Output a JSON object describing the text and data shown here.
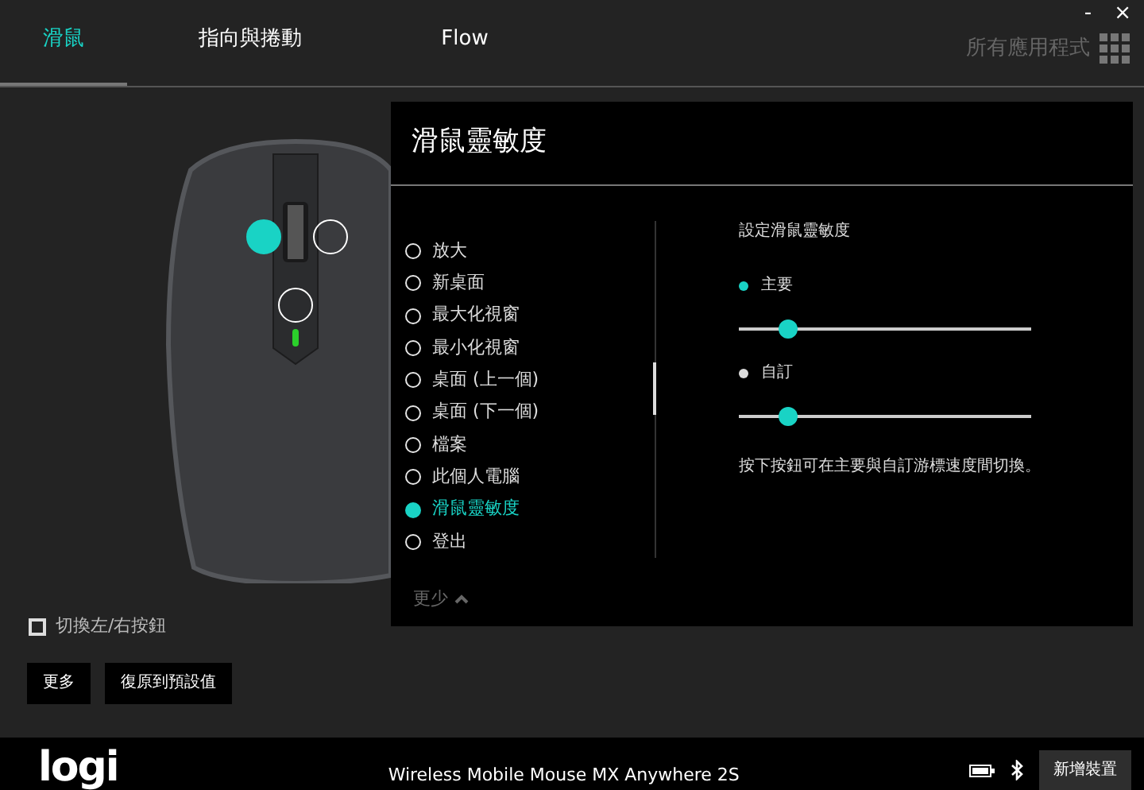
{
  "window": {
    "controls": [
      "-",
      "×"
    ]
  },
  "tabs": [
    {
      "label": "滑鼠",
      "selected": true
    },
    {
      "label": "指向與捲動",
      "selected": false
    },
    {
      "label": "Flow",
      "selected": false
    }
  ],
  "apps_link": {
    "label": "所有應用程式"
  },
  "hotspots": [
    {
      "selected": true
    },
    {
      "selected": false
    },
    {
      "selected": false
    }
  ],
  "swap_buttons": {
    "label": "切換左/右按鈕",
    "checked": false
  },
  "buttons": [
    "更多",
    "復原到預設值"
  ],
  "panel": {
    "title": "滑鼠靈敏度",
    "actions": [
      {
        "label": "放大",
        "selected": false
      },
      {
        "label": "新桌面",
        "selected": false
      },
      {
        "label": "最大化視窗",
        "selected": false
      },
      {
        "label": "最小化視窗",
        "selected": false
      },
      {
        "label": "桌面 (上一個)",
        "selected": false
      },
      {
        "label": "桌面 (下一個)",
        "selected": false
      },
      {
        "label": "檔案",
        "selected": false
      },
      {
        "label": "此個人電腦",
        "selected": false
      },
      {
        "label": "滑鼠靈敏度",
        "selected": true
      },
      {
        "label": "登出",
        "selected": false
      }
    ],
    "collapse": "更少",
    "settings": {
      "title": "設定滑鼠靈敏度",
      "options": [
        {
          "label": "主要",
          "selected": true,
          "level": 0.17
        },
        {
          "label": "自訂",
          "selected": false,
          "level": 0.17
        }
      ],
      "hint": "按下按鈕可在主要與自訂游標速度間切換。"
    }
  },
  "footer": {
    "logo": "logi",
    "device": "Wireless Mobile Mouse MX Anywhere 2S",
    "add_button": "新增裝置"
  }
}
